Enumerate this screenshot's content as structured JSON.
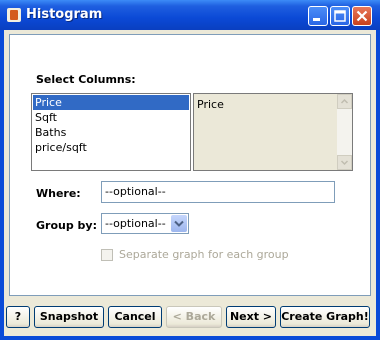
{
  "window": {
    "title": "Histogram"
  },
  "columns": {
    "label": "Select Columns:",
    "available": [
      "Price",
      "Sqft",
      "Baths",
      "price/sqft"
    ],
    "selected_index": 0,
    "chosen": [
      "Price"
    ]
  },
  "where": {
    "label": "Where:",
    "value": "--optional--"
  },
  "groupby": {
    "label": "Group by:",
    "value": "--optional--"
  },
  "separate": {
    "label": "Separate graph for each group",
    "checked": false,
    "enabled": false
  },
  "buttons": {
    "help": "?",
    "snapshot": "Snapshot",
    "cancel": "Cancel",
    "back": "< Back",
    "next": "Next >",
    "create": "Create Graph!"
  }
}
